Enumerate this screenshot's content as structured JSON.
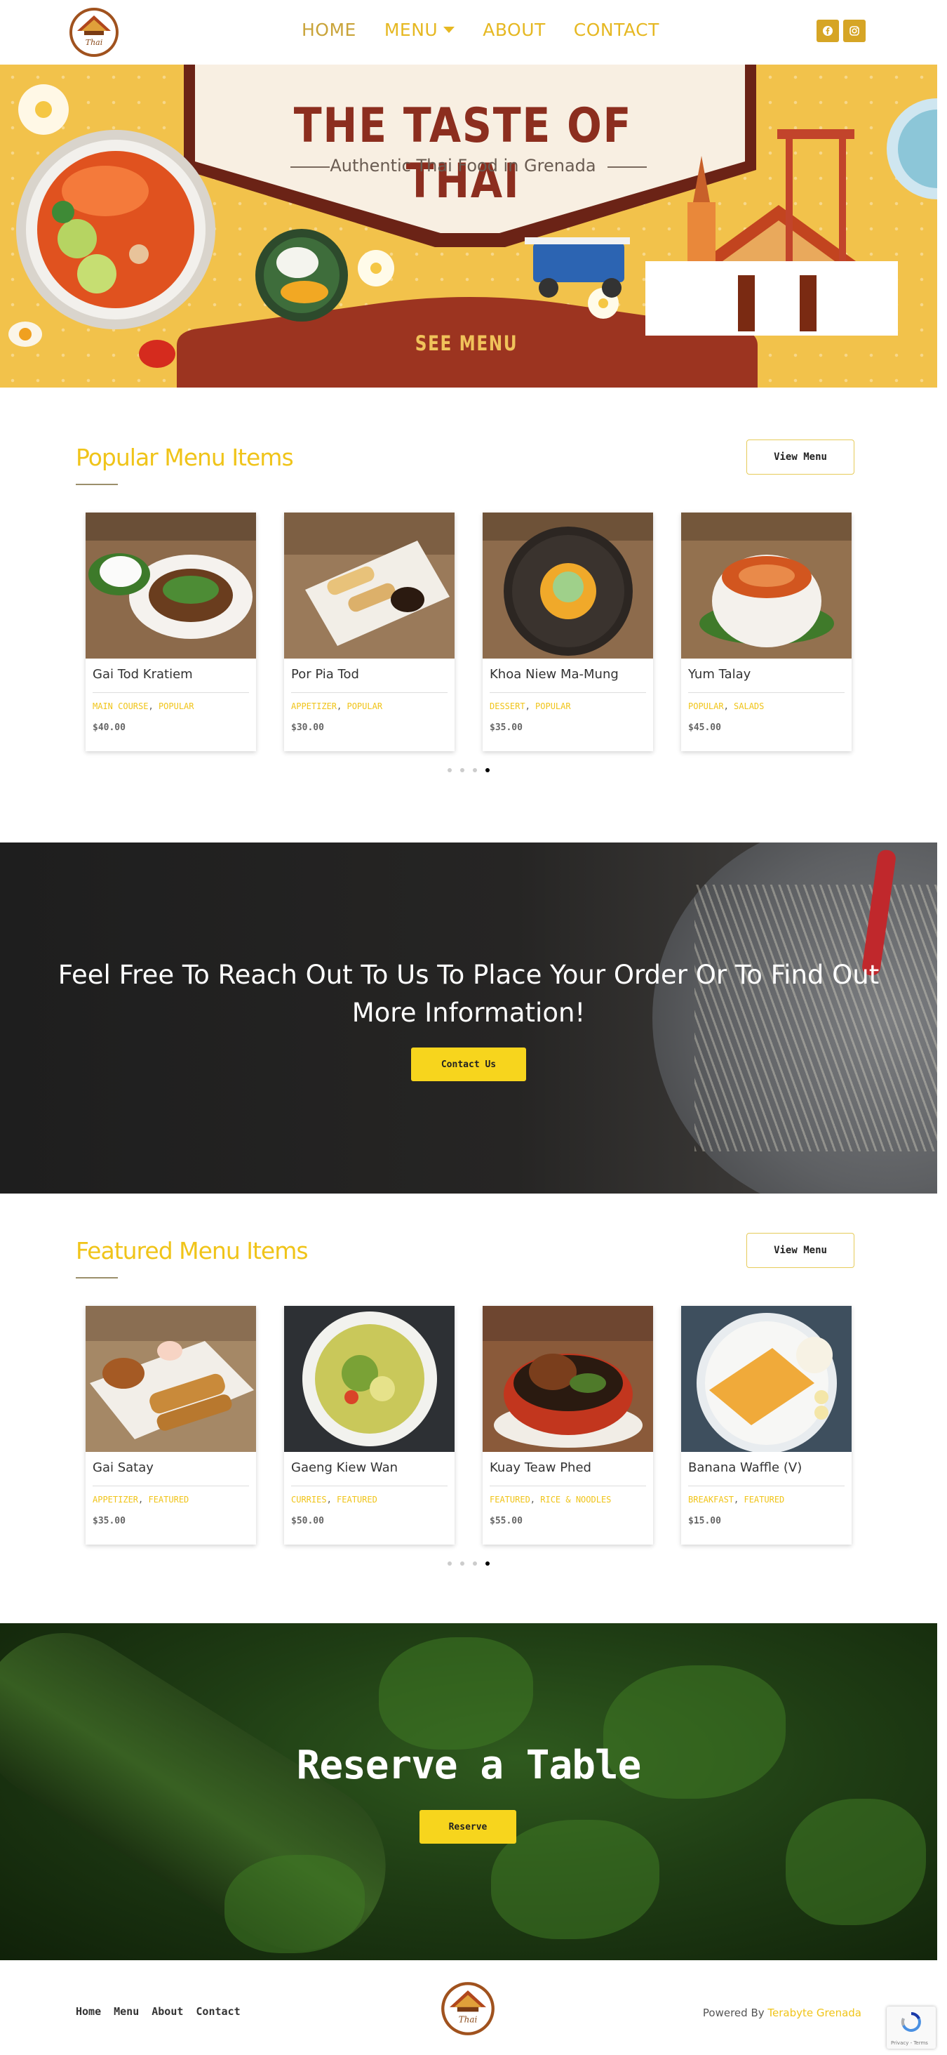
{
  "nav": {
    "home": "HOME",
    "menu": "MENU",
    "about": "ABOUT",
    "contact": "CONTACT"
  },
  "social": [
    "facebook-icon",
    "instagram-icon"
  ],
  "hero": {
    "title": "THE TASTE OF THAI",
    "subtitle": "Authentic Thai Food in Grenada",
    "cta": "SEE MENU"
  },
  "popular": {
    "title": "Popular Menu Items",
    "button": "View Menu",
    "items": [
      {
        "name": "Gai Tod Kratiem",
        "tag1": "MAIN COURSE",
        "tag2": "POPULAR",
        "price": "$40.00"
      },
      {
        "name": "Por Pia Tod",
        "tag1": "APPETIZER",
        "tag2": "POPULAR",
        "price": "$30.00"
      },
      {
        "name": "Khoa Niew Ma-Mung",
        "tag1": "DESSERT",
        "tag2": "POPULAR",
        "price": "$35.00"
      },
      {
        "name": "Yum Talay",
        "tag1": "POPULAR",
        "tag2": "SALADS",
        "price": "$45.00"
      }
    ],
    "active_dot": 4
  },
  "contact_band": {
    "text": "Feel Free To Reach Out To Us To Place Your Order Or To Find Out More Information!",
    "button": "Contact Us"
  },
  "featured": {
    "title": "Featured Menu Items",
    "button": "View Menu",
    "items": [
      {
        "name": "Gai Satay",
        "tag1": "APPETIZER",
        "tag2": "FEATURED",
        "price": "$35.00"
      },
      {
        "name": "Gaeng Kiew Wan",
        "tag1": "CURRIES",
        "tag2": "FEATURED",
        "price": "$50.00"
      },
      {
        "name": "Kuay Teaw Phed",
        "tag1": "FEATURED",
        "tag2": "RICE & NOODLES",
        "price": "$55.00"
      },
      {
        "name": "Banana Waffle (V)",
        "tag1": "BREAKFAST",
        "tag2": "FEATURED",
        "price": "$15.00"
      }
    ],
    "active_dot": 4
  },
  "reserve": {
    "title": "Reserve a Table",
    "button": "Reserve"
  },
  "footer": {
    "links": [
      "Home",
      "Menu",
      "About",
      "Contact"
    ],
    "powered_prefix": "Powered By",
    "powered_link": "Terabyte Grenada"
  },
  "recaptcha": {
    "text": "Privacy - Terms"
  },
  "colors": {
    "accent": "#f0c419",
    "brand_brown": "#8c2e1f",
    "hero_bg": "#f2c24b"
  }
}
